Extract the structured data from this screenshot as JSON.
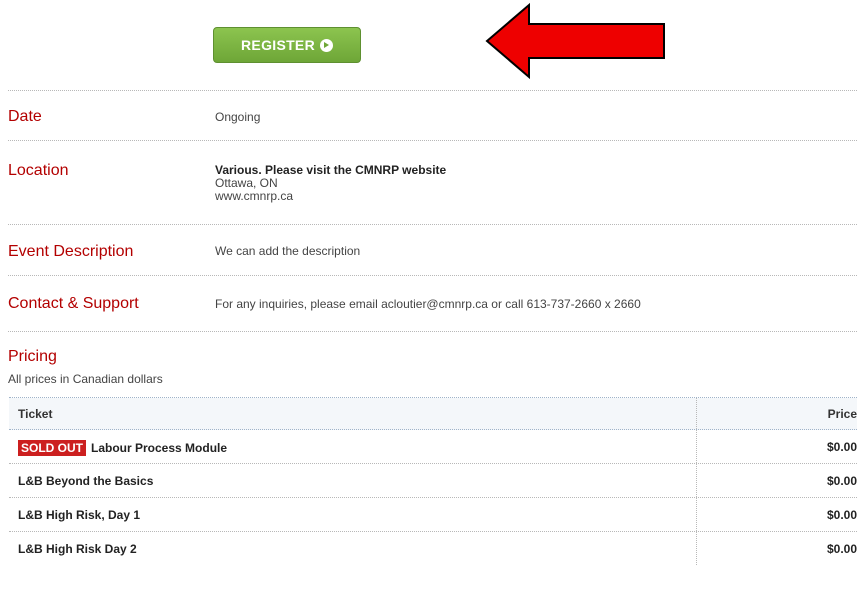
{
  "register": {
    "label": "REGISTER"
  },
  "details": [
    {
      "label": "Date",
      "value": "Ongoing"
    },
    {
      "label": "Location",
      "venue": "Various. Please visit the CMNRP website",
      "city": "Ottawa, ON",
      "website": "www.cmnrp.ca"
    },
    {
      "label": "Event Description",
      "value": "We can add the description"
    },
    {
      "label": "Contact & Support",
      "value": "For any inquiries, please email acloutier@cmnrp.ca or call 613-737-2660 x 2660"
    }
  ],
  "pricing": {
    "title": "Pricing",
    "subtitle": "All prices in Canadian dollars",
    "headers": {
      "ticket": "Ticket",
      "price": "Price"
    },
    "sold_out_badge": "SOLD OUT",
    "rows": [
      {
        "name": "Labour Process Module",
        "price": "$0.00"
      },
      {
        "name": "L&B Beyond the Basics",
        "price": "$0.00"
      },
      {
        "name": "L&B High Risk, Day 1",
        "price": "$0.00"
      },
      {
        "name": "L&B High Risk Day 2",
        "price": "$0.00"
      }
    ]
  },
  "colors": {
    "accent_red": "#b30000",
    "button_green": "#7ab543",
    "sold_out_red": "#cc1f1f"
  }
}
